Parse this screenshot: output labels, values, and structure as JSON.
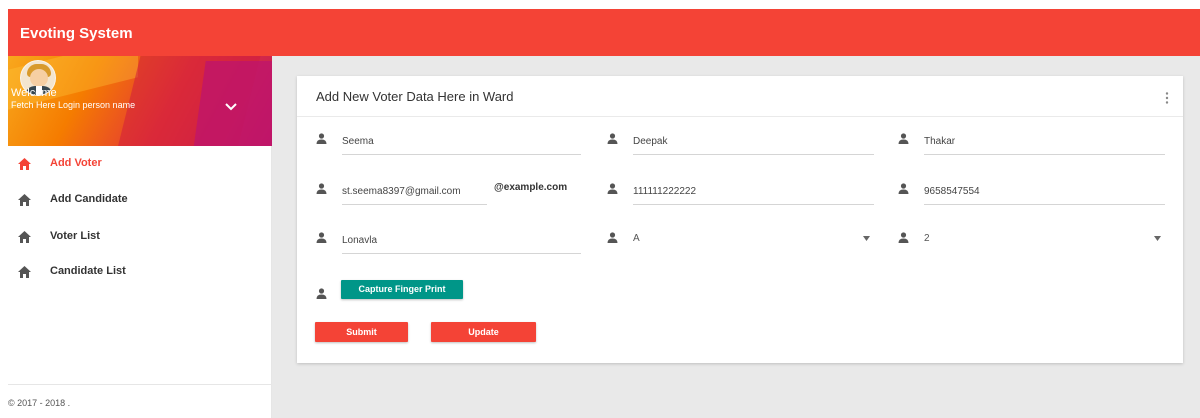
{
  "app": {
    "title": "Evoting System"
  },
  "user": {
    "welcome": "Welcome",
    "login_name": "Fetch Here Login person name"
  },
  "sidebar": {
    "items": [
      {
        "label": "Add Voter",
        "icon": "home-icon",
        "active": true
      },
      {
        "label": "Add Candidate",
        "icon": "home-icon",
        "active": false
      },
      {
        "label": "Voter List",
        "icon": "home-icon",
        "active": false
      },
      {
        "label": "Candidate List",
        "icon": "home-icon",
        "active": false
      }
    ],
    "copyright": "© 2017 - 2018 ."
  },
  "form": {
    "title": "Add New Voter Data Here in Ward",
    "first_name": "Seema",
    "middle_name": "Deepak",
    "last_name": "Thakar",
    "email": "st.seema8397@gmail.com",
    "email_suffix": "@example.com",
    "id_number": "111111222222",
    "phone": "9658547554",
    "city": "Lonavla",
    "ward": "A",
    "booth": "2",
    "capture_label": "Capture Finger Print",
    "submit_label": "Submit",
    "update_label": "Update"
  },
  "colors": {
    "primary": "#f44336",
    "accent": "#009688"
  },
  "icons": {
    "field": "person-icon",
    "menu": "more-vert-icon",
    "chevron": "chevron-down-icon"
  }
}
